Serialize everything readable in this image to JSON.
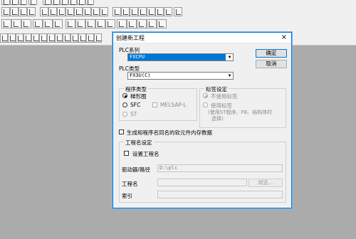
{
  "dialog": {
    "title": "创建新工程",
    "close_glyph": "×",
    "plc_series": {
      "label": "PLC系列",
      "value": "FXCPU"
    },
    "plc_type": {
      "label": "PLC类型",
      "value": "FX3U(C)"
    },
    "buttons": {
      "ok": "确定",
      "cancel": "取消"
    },
    "program_type": {
      "title": "程序类型",
      "ladder": "梯形图",
      "sfc": "SFC",
      "melsap": "MELSAP-L",
      "st": "ST"
    },
    "label_settings": {
      "title": "标签设定",
      "no_label": "不使用标签",
      "use_label": "使用标签",
      "use_label_note1": "(使用ST程序、FB、结构体时",
      "use_label_note2": "选择)"
    },
    "gen_check": "生成和程序名同名的软元件内存数据",
    "project_name": {
      "title": "工程名设定",
      "set_name": "设置工程名",
      "drive_path_label": "驱动器/路径",
      "drive_path_value": "D:\\plc",
      "project_name_label": "工程名",
      "browse": "浏览...",
      "title_label": "索引"
    }
  }
}
